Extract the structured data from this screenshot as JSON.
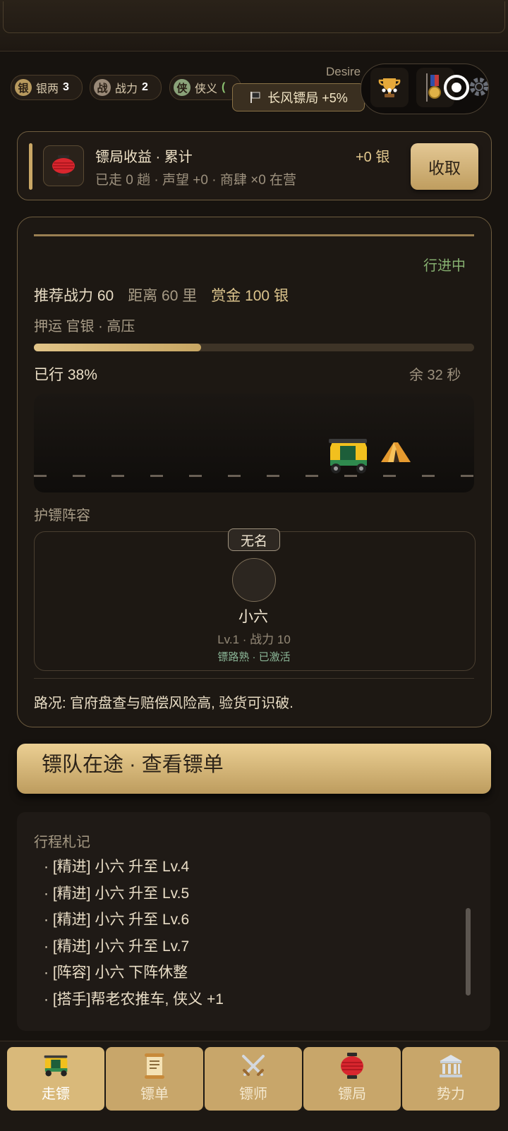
{
  "resources": [
    {
      "badge": "银",
      "label": "银两",
      "value": "3",
      "badge_color": "#b89a5e"
    },
    {
      "badge": "战",
      "label": "战力",
      "value": "2",
      "badge_color": "#9a8a78"
    },
    {
      "badge": "侠",
      "label": "侠义",
      "value": "(",
      "badge_color": "#8aa279"
    }
  ],
  "header": {
    "user": "Desire",
    "bonus_tag": "长风镖局 +5%"
  },
  "income": {
    "title": "镖局收益 · 累计",
    "subtitle": "已走 0 趟 · 声望 +0 · 商肆 ×0 在营",
    "value": "+0 银",
    "collect_label": "收取"
  },
  "mission": {
    "status": "行进中",
    "recommend_power": "推荐战力 60",
    "distance": "距离 60 里",
    "reward": "赏金 100 银",
    "escort": "押运 官银 · 高压",
    "progress_fraction": 0.38,
    "walked_label": "已行 38%",
    "remain_label": "余 32 秒",
    "guard_title": "护镖阵容",
    "guard": {
      "tag": "无名",
      "name": "小六",
      "level_line": "Lv.1 · 战力 10",
      "skill_line": "镖路熟 · 已激活"
    },
    "road_condition": "路况: 官府盘查与赔偿风险高, 验货可识破."
  },
  "main_button": "镖队在途 · 查看镖单",
  "log": {
    "title": "行程札记",
    "items": [
      "· [精进] 小六 升至 Lv.4",
      "· [精进] 小六 升至 Lv.5",
      "· [精进] 小六 升至 Lv.6",
      "· [精进] 小六 升至 Lv.7",
      "· [阵容] 小六 下阵休整",
      "· [搭手]帮老农推车, 侠义 +1"
    ]
  },
  "tabs": [
    {
      "label": "走镖",
      "icon": "rickshaw-icon"
    },
    {
      "label": "镖单",
      "icon": "scroll-icon"
    },
    {
      "label": "镖师",
      "icon": "crossed-swords-icon"
    },
    {
      "label": "镖局",
      "icon": "lantern-icon"
    },
    {
      "label": "势力",
      "icon": "classical-building-icon"
    }
  ],
  "colors": {
    "accent_gold": "#d9b97a",
    "status_green": "#86b070",
    "background": "#17130f"
  }
}
